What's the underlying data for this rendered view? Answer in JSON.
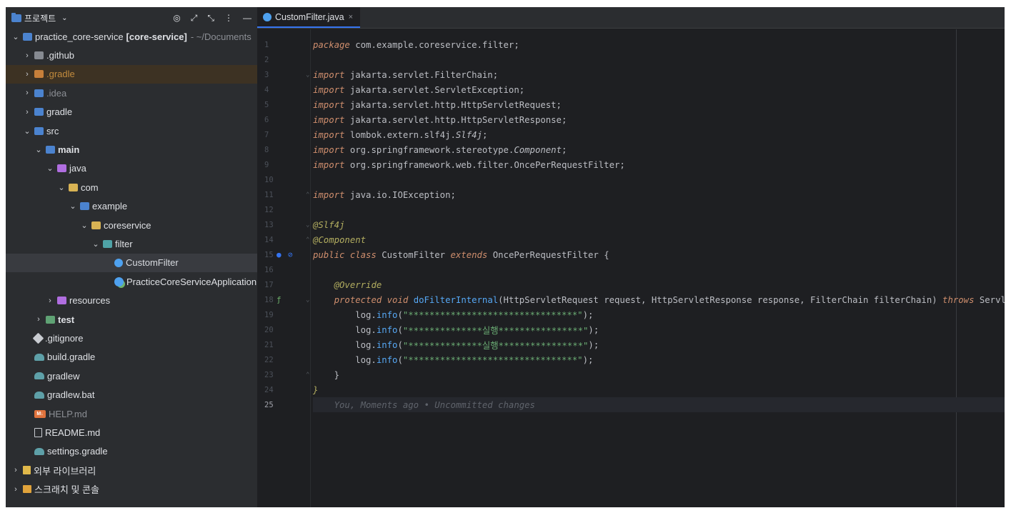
{
  "project_panel": {
    "title": "프로젝트",
    "icons": [
      "folder-icon",
      "chevron-down-icon",
      "target-icon",
      "expand-icon",
      "collapse-icon",
      "more-icon",
      "hide-icon"
    ],
    "tree": [
      {
        "label": "practice_core-service",
        "bold_suffix": "[core-service]",
        "hint": "- ~/Documents",
        "indent": 0,
        "arrow": "open",
        "icon": "folder-blue"
      },
      {
        "label": ".github",
        "indent": 1,
        "arrow": "closed",
        "icon": "folder-gray"
      },
      {
        "label": ".gradle",
        "indent": 1,
        "arrow": "closed",
        "icon": "folder-orange",
        "style": "orange",
        "highlight": true
      },
      {
        "label": ".idea",
        "indent": 1,
        "arrow": "closed",
        "icon": "folder-blue",
        "style": "gray"
      },
      {
        "label": "gradle",
        "indent": 1,
        "arrow": "closed",
        "icon": "folder-blue"
      },
      {
        "label": "src",
        "indent": 1,
        "arrow": "open",
        "icon": "folder-blue"
      },
      {
        "label": "main",
        "indent": 2,
        "arrow": "open",
        "icon": "folder-blue",
        "style": "bold"
      },
      {
        "label": "java",
        "indent": 3,
        "arrow": "open",
        "icon": "folder-purple"
      },
      {
        "label": "com",
        "indent": 4,
        "arrow": "open",
        "icon": "folder-yellow"
      },
      {
        "label": "example",
        "indent": 5,
        "arrow": "open",
        "icon": "folder-blue"
      },
      {
        "label": "coreservice",
        "indent": 6,
        "arrow": "open",
        "icon": "folder-yellow"
      },
      {
        "label": "filter",
        "indent": 7,
        "arrow": "open",
        "icon": "folder-teal"
      },
      {
        "label": "CustomFilter",
        "indent": 8,
        "arrow": "none",
        "icon": "class",
        "selected": true
      },
      {
        "label": "PracticeCoreServiceApplication",
        "indent": 8,
        "arrow": "none",
        "icon": "springapp"
      },
      {
        "label": "resources",
        "indent": 3,
        "arrow": "closed",
        "icon": "folder-purple"
      },
      {
        "label": "test",
        "indent": 2,
        "arrow": "closed",
        "icon": "folder-green",
        "style": "bold"
      },
      {
        "label": ".gitignore",
        "indent": 1,
        "arrow": "none",
        "icon": "git"
      },
      {
        "label": "build.gradle",
        "indent": 1,
        "arrow": "none",
        "icon": "elephant"
      },
      {
        "label": "gradlew",
        "indent": 1,
        "arrow": "none",
        "icon": "elephant"
      },
      {
        "label": "gradlew.bat",
        "indent": 1,
        "arrow": "none",
        "icon": "elephant"
      },
      {
        "label": "HELP.md",
        "indent": 1,
        "arrow": "none",
        "icon": "md",
        "style": "gray"
      },
      {
        "label": "README.md",
        "indent": 1,
        "arrow": "none",
        "icon": "doc"
      },
      {
        "label": "settings.gradle",
        "indent": 1,
        "arrow": "none",
        "icon": "elephant"
      },
      {
        "label": "외부 라이브러리",
        "indent": 0,
        "arrow": "closed",
        "icon": "lib"
      },
      {
        "label": "스크래치 및 콘솔",
        "indent": 0,
        "arrow": "closed",
        "icon": "scratch"
      }
    ]
  },
  "editor": {
    "tab": {
      "label": "CustomFilter.java",
      "close": "×"
    },
    "current_line": 25,
    "lines": [
      {
        "n": "1",
        "tokens": [
          [
            "kwi",
            "package"
          ],
          [
            "p",
            " com.example.coreservice.filter;"
          ]
        ]
      },
      {
        "n": "2",
        "tokens": []
      },
      {
        "n": "3",
        "fold": "⌄",
        "tokens": [
          [
            "kwi",
            "import"
          ],
          [
            "p",
            " jakarta.servlet.FilterChain;"
          ]
        ]
      },
      {
        "n": "4",
        "tokens": [
          [
            "kwi",
            "import"
          ],
          [
            "p",
            " jakarta.servlet.ServletException;"
          ]
        ]
      },
      {
        "n": "5",
        "tokens": [
          [
            "kwi",
            "import"
          ],
          [
            "p",
            " jakarta.servlet.http.HttpServletRequest;"
          ]
        ]
      },
      {
        "n": "6",
        "tokens": [
          [
            "kwi",
            "import"
          ],
          [
            "p",
            " jakarta.servlet.http.HttpServletResponse;"
          ]
        ]
      },
      {
        "n": "7",
        "tokens": [
          [
            "kwi",
            "import"
          ],
          [
            "p",
            " lombok.extern.slf4j."
          ],
          [
            "ital",
            "Slf4j"
          ],
          [
            "p",
            ";"
          ]
        ]
      },
      {
        "n": "8",
        "tokens": [
          [
            "kwi",
            "import"
          ],
          [
            "p",
            " org.springframework.stereotype."
          ],
          [
            "ital",
            "Component"
          ],
          [
            "p",
            ";"
          ]
        ]
      },
      {
        "n": "9",
        "tokens": [
          [
            "kwi",
            "import"
          ],
          [
            "p",
            " org.springframework.web.filter.OncePerRequestFilter;"
          ]
        ]
      },
      {
        "n": "10",
        "tokens": []
      },
      {
        "n": "11",
        "fold": "⌃",
        "tokens": [
          [
            "kwi",
            "import"
          ],
          [
            "p",
            " java.io.IOException;"
          ]
        ]
      },
      {
        "n": "12",
        "tokens": []
      },
      {
        "n": "13",
        "fold": "⌄",
        "tokens": [
          [
            "ann",
            "@Slf4j"
          ]
        ]
      },
      {
        "n": "14",
        "fold": "⌃",
        "tokens": [
          [
            "ann",
            "@Component"
          ]
        ]
      },
      {
        "n": "15",
        "marks": [
          "●",
          "⊘"
        ],
        "tokens": [
          [
            "kwi",
            "public class"
          ],
          [
            "p",
            " CustomFilter "
          ],
          [
            "kwi",
            "extends"
          ],
          [
            "p",
            " OncePerRequestFilter {"
          ]
        ]
      },
      {
        "n": "16",
        "tokens": []
      },
      {
        "n": "17",
        "tokens": [
          [
            "p",
            "    "
          ],
          [
            "ann",
            "@Override"
          ]
        ]
      },
      {
        "n": "18",
        "marks": [
          "ƒ"
        ],
        "fold": "⌄",
        "tokens": [
          [
            "p",
            "    "
          ],
          [
            "kwi",
            "protected void"
          ],
          [
            "p",
            " "
          ],
          [
            "fn",
            "doFilterInternal"
          ],
          [
            "p",
            "(HttpServletRequest request, HttpServletResponse response, FilterChain filterChain) "
          ],
          [
            "kwi",
            "throws"
          ],
          [
            "p",
            " ServletException"
          ]
        ]
      },
      {
        "n": "19",
        "tokens": [
          [
            "p",
            "        log."
          ],
          [
            "fn",
            "info"
          ],
          [
            "p",
            "("
          ],
          [
            "str",
            "\"********************************\""
          ],
          [
            "p",
            ");"
          ]
        ]
      },
      {
        "n": "20",
        "tokens": [
          [
            "p",
            "        log."
          ],
          [
            "fn",
            "info"
          ],
          [
            "p",
            "("
          ],
          [
            "str",
            "\"**************실행****************\""
          ],
          [
            "p",
            ");"
          ]
        ]
      },
      {
        "n": "21",
        "tokens": [
          [
            "p",
            "        log."
          ],
          [
            "fn",
            "info"
          ],
          [
            "p",
            "("
          ],
          [
            "str",
            "\"**************실행****************\""
          ],
          [
            "p",
            ");"
          ]
        ]
      },
      {
        "n": "22",
        "tokens": [
          [
            "p",
            "        log."
          ],
          [
            "fn",
            "info"
          ],
          [
            "p",
            "("
          ],
          [
            "str",
            "\"********************************\""
          ],
          [
            "p",
            ");"
          ]
        ]
      },
      {
        "n": "23",
        "fold": "⌃",
        "tokens": [
          [
            "p",
            "    }"
          ]
        ]
      },
      {
        "n": "24",
        "tokens": [
          [
            "ann",
            "}"
          ]
        ]
      },
      {
        "n": "25",
        "tokens": [
          [
            "blame",
            "    You, Moments ago • Uncommitted changes"
          ]
        ]
      }
    ]
  }
}
